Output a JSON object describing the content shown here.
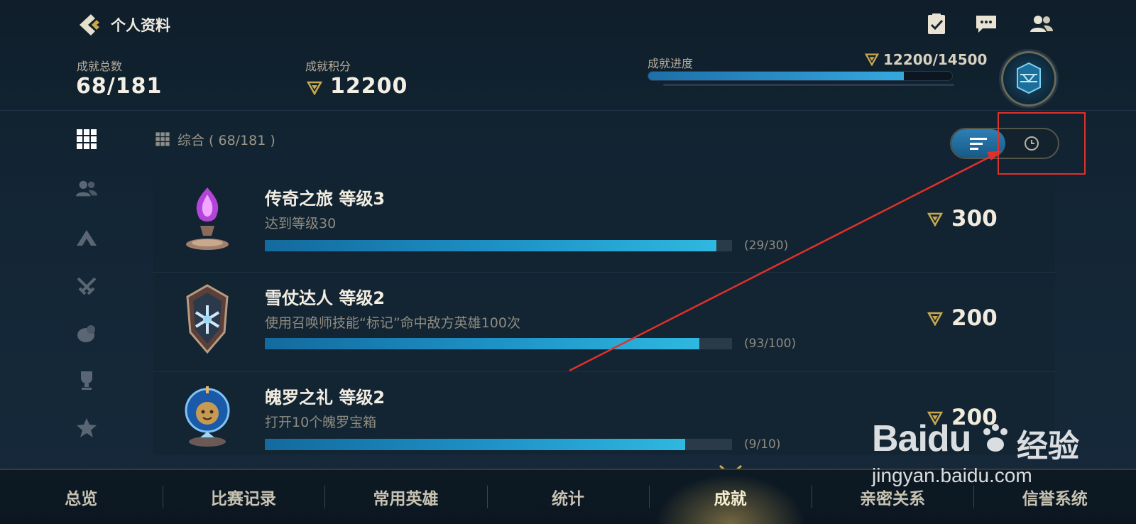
{
  "header": {
    "title": "个人资料",
    "icons": [
      "back-icon",
      "task-checklist-icon",
      "chat-icon",
      "friends-icon"
    ]
  },
  "summary": {
    "total_label": "成就总数",
    "total_value": "68/181",
    "points_label": "成就积分",
    "points_value": "12200",
    "progress_label": "成就进度",
    "progress_value": "12200/14500",
    "progress_fraction": 0.841
  },
  "sidebar": {
    "items": [
      "grid-icon",
      "friends-icon",
      "rank-icon",
      "crossed-swords-icon",
      "disc-icon",
      "trophy-icon",
      "star-icon"
    ],
    "active": 0
  },
  "filter": {
    "label": "综合 ( 68/181 )"
  },
  "view_toggle": {
    "options": [
      "sort-icon",
      "clock-icon"
    ],
    "active": 0
  },
  "achievements": [
    {
      "name": "传奇之旅  等级3",
      "desc": "达到等级30",
      "count": "(29/30)",
      "progress": 0.967,
      "points": "300",
      "icon": "purple-crystal-trophy-icon"
    },
    {
      "name": "雪仗达人  等级2",
      "desc": "使用召唤师技能“标记”命中敌方英雄100次",
      "count": "(93/100)",
      "progress": 0.93,
      "points": "200",
      "icon": "snowflake-shield-icon"
    },
    {
      "name": "魄罗之礼  等级2",
      "desc": "打开10个魄罗宝箱",
      "count": "(9/10)",
      "progress": 0.9,
      "points": "200",
      "icon": "poro-orb-icon"
    }
  ],
  "bottom_nav": {
    "tabs": [
      "总览",
      "比赛记录",
      "常用英雄",
      "统计",
      "成就",
      "亲密关系",
      "信誉系统"
    ],
    "active": 4
  },
  "watermark": {
    "brand": "Baidu",
    "suffix": "经验",
    "url": "jingyan.baidu.com"
  },
  "colors": {
    "accent_blue": "#2fb8e0",
    "gold": "#c9a94e",
    "annotation_red": "#e0302a"
  }
}
